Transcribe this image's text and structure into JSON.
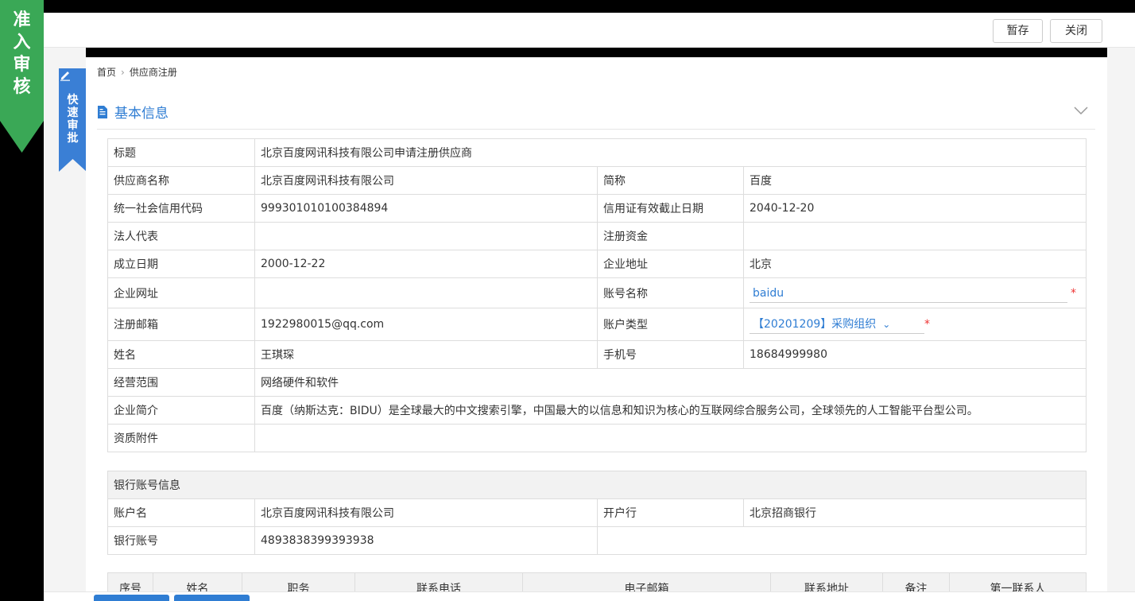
{
  "ribbon": {
    "chars": [
      "准",
      "入",
      "审",
      "核"
    ],
    "color": "#3aa856"
  },
  "toolbar": {
    "save_label": "暂存",
    "close_label": "关闭"
  },
  "quick_approve": {
    "chars": [
      "快",
      "速",
      "审",
      "批"
    ],
    "color": "#3a7fd5"
  },
  "breadcrumb": {
    "home": "首页",
    "current": "供应商注册"
  },
  "section": {
    "title": "基本信息"
  },
  "basic": {
    "title_label": "标题",
    "title_value": "北京百度网讯科技有限公司申请注册供应商",
    "supplier_name_label": "供应商名称",
    "supplier_name_value": "北京百度网讯科技有限公司",
    "short_name_label": "简称",
    "short_name_value": "百度",
    "credit_code_label": "统一社会信用代码",
    "credit_code_value": "999301010100384894",
    "credit_expiry_label": "信用证有效截止日期",
    "credit_expiry_value": "2040-12-20",
    "legal_rep_label": "法人代表",
    "legal_rep_value": "",
    "reg_capital_label": "注册资金",
    "reg_capital_value": "",
    "founded_label": "成立日期",
    "founded_value": "2000-12-22",
    "address_label": "企业地址",
    "address_value": "北京",
    "website_label": "企业网址",
    "website_value": "",
    "account_name_label": "账号名称",
    "account_name_value": "baidu",
    "email_label": "注册邮箱",
    "email_value": "1922980015@qq.com",
    "account_type_label": "账户类型",
    "account_type_value": "【20201209】采购组织",
    "person_label": "姓名",
    "person_value": "王琪琛",
    "phone_label": "手机号",
    "phone_value": "18684999980",
    "scope_label": "经营范围",
    "scope_value": "网络硬件和软件",
    "intro_label": "企业简介",
    "intro_value": "百度（纳斯达克：BIDU）是全球最大的中文搜索引擎，中国最大的以信息和知识为核心的互联网综合服务公司，全球领先的人工智能平台型公司。",
    "attachments_label": "资质附件",
    "attachments_value": ""
  },
  "bank": {
    "header": "银行账号信息",
    "account_holder_label": "账户名",
    "account_holder_value": "北京百度网讯科技有限公司",
    "bank_label": "开户行",
    "bank_value": "北京招商银行",
    "account_no_label": "银行账号",
    "account_no_value": "4893838399393938"
  },
  "contacts": {
    "headers": [
      "序号",
      "姓名",
      "职务",
      "联系电话",
      "电子邮箱",
      "联系地址",
      "备注",
      "第一联系人"
    ]
  }
}
